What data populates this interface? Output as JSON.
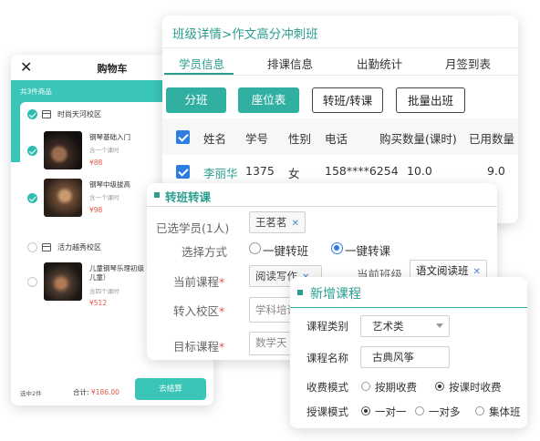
{
  "cart": {
    "title": "购物车",
    "count_label": "共3件商品",
    "stores": [
      {
        "name": "时尚天河校区",
        "checked": true,
        "items": [
          {
            "name": "钢琴基础入门",
            "sub": "含一个课时",
            "price": "¥88",
            "checked": true
          },
          {
            "name": "钢琴中级拔高",
            "sub": "含一个课时",
            "price": "¥98",
            "checked": true
          }
        ]
      },
      {
        "name": "活力越秀校区",
        "checked": false,
        "items": [
          {
            "name": "儿童钢琴乐理初级 —12岁儿童）",
            "sub": "含四个课时",
            "price": "¥512",
            "checked": false
          }
        ]
      }
    ],
    "footer": {
      "selected": "选中2件",
      "total_label": "合计:",
      "total_value": "¥186.00",
      "pay_button": "去结算"
    }
  },
  "class_detail": {
    "title": "班级详情>作文高分冲刺班",
    "tabs": [
      "学员信息",
      "排课信息",
      "出勤统计",
      "月签到表"
    ],
    "active_tab": 0,
    "buttons": [
      "分班",
      "座位表",
      "转班/转课",
      "批量出班"
    ],
    "table": {
      "headers": [
        "姓名",
        "学号",
        "性别",
        "电话",
        "购买数量(课时)",
        "已用数量"
      ],
      "rows": [
        [
          "李丽华",
          "1375",
          "女",
          "158****6254",
          "10.0",
          "9.0"
        ]
      ]
    }
  },
  "transfer": {
    "title": "转班转课",
    "selected_label": "已选学员(1人)",
    "selected_student": "王茗茗",
    "method_label": "选择方式",
    "method_options": [
      "一键转班",
      "一键转课"
    ],
    "method_selected": 1,
    "current_course_label": "当前课程",
    "current_course": "阅读写作",
    "current_class_label": "当前班级",
    "current_class": "语文阅读班",
    "target_campus_label": "转入校区",
    "target_campus": "学科培训",
    "target_course_label": "目标课程",
    "target_course": "数学天"
  },
  "new_course": {
    "title": "新增课程",
    "category_label": "课程类别",
    "category_value": "艺术类",
    "name_label": "课程名称",
    "name_value": "古典风筝",
    "fee_label": "收费模式",
    "fee_options": [
      "按期收费",
      "按课时收费"
    ],
    "fee_selected": 1,
    "teach_label": "授课模式",
    "teach_options": [
      "一对一",
      "一对多",
      "集体班"
    ],
    "teach_selected": 0
  },
  "colors": {
    "accent": "#2a9d8f",
    "cart_band": "#39c5b8",
    "price": "#e65a4a",
    "checkbox": "#2e7de0"
  }
}
